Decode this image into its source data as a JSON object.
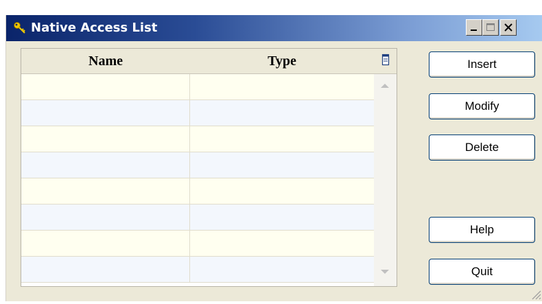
{
  "window": {
    "title": "Native Access List",
    "controls": {
      "minimize": "minimize",
      "maximize": "maximize",
      "close": "close"
    }
  },
  "table": {
    "columns": [
      "Name",
      "Type"
    ],
    "column_chooser_icon": "column-chooser-icon",
    "rows": [
      {
        "name": "",
        "type": ""
      },
      {
        "name": "",
        "type": ""
      },
      {
        "name": "",
        "type": ""
      },
      {
        "name": "",
        "type": ""
      },
      {
        "name": "",
        "type": ""
      },
      {
        "name": "",
        "type": ""
      },
      {
        "name": "",
        "type": ""
      },
      {
        "name": "",
        "type": ""
      }
    ],
    "row_colors": [
      "#fffff0",
      "#f3f7fd"
    ]
  },
  "buttons": {
    "insert": "Insert",
    "modify": "Modify",
    "delete": "Delete",
    "help": "Help",
    "quit": "Quit"
  },
  "colors": {
    "titlebar_start": "#0a246a",
    "titlebar_end": "#a6caf0",
    "button_border": "#003c74",
    "window_bg": "#ece9d8"
  }
}
